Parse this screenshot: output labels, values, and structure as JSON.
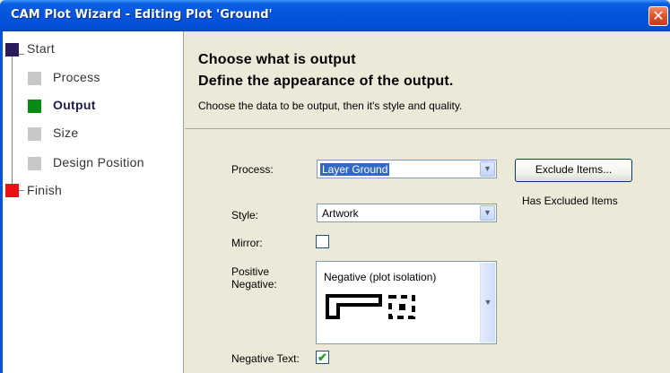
{
  "window": {
    "title": "CAM Plot Wizard - Editing Plot 'Ground'",
    "close_glyph": "✕"
  },
  "sidebar": {
    "steps": [
      {
        "label": "Start",
        "color": "#2a1c5c"
      },
      {
        "label": "Process",
        "color": "#c8c8c8"
      },
      {
        "label": "Output",
        "color": "#0a8a14",
        "current": true
      },
      {
        "label": "Size",
        "color": "#c8c8c8"
      },
      {
        "label": "Design Position",
        "color": "#c8c8c8"
      },
      {
        "label": "Finish",
        "color": "#ee1111"
      }
    ]
  },
  "main": {
    "heading1": "Choose what is output",
    "heading2": "Define the appearance of the output.",
    "subtext": "Choose the data to be output, then it's style and quality.",
    "process_label": "Process:",
    "process_value": "Layer Ground",
    "exclude_button": "Exclude Items...",
    "excluded_note": "Has Excluded Items",
    "style_label": "Style:",
    "style_value": "Artwork",
    "mirror_label": "Mirror:",
    "mirror_checked": false,
    "polarity_label_1": "Positive",
    "polarity_label_2": "Negative:",
    "polarity_value": "Negative (plot isolation)",
    "negative_text_label": "Negative Text:",
    "negative_text_checked": true
  },
  "icons": {
    "dropdown": "chevron-down-icon",
    "check": "checkmark-icon"
  }
}
